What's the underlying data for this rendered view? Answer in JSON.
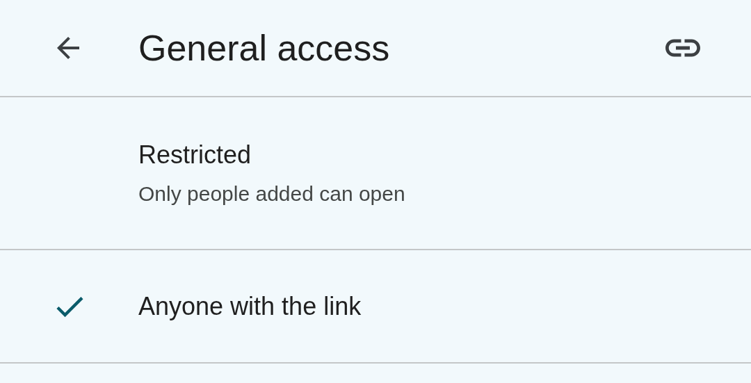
{
  "header": {
    "title": "General access"
  },
  "options": [
    {
      "label": "Restricted",
      "description": "Only people added can open",
      "selected": false
    },
    {
      "label": "Anyone with the link",
      "selected": true
    }
  ]
}
